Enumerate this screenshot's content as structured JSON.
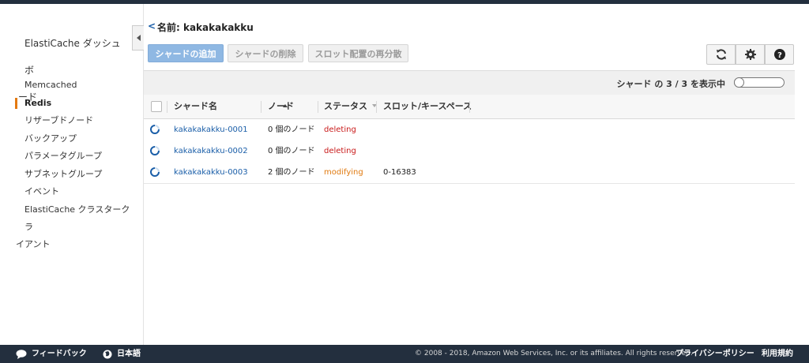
{
  "sidebar": {
    "title_line1": "ElastiCache ダッシュボ",
    "title_line2": "ード",
    "items": [
      {
        "label": "Memcached"
      },
      {
        "label": "Redis"
      },
      {
        "label": "リザーブドノード"
      },
      {
        "label": "バックアップ"
      },
      {
        "label": "パラメータグループ"
      },
      {
        "label": "サブネットグループ"
      },
      {
        "label": "イベント"
      }
    ],
    "client_line1": "ElastiCache クラスタークラ",
    "client_line2": "イアント"
  },
  "header": {
    "back": "<",
    "title": "名前: kakakakakku"
  },
  "toolbar": {
    "add_shard": "シャードの追加",
    "delete_shard": "シャードの削除",
    "redistribute_slots": "スロット配置の再分散"
  },
  "icons": {
    "refresh": "refresh-icon",
    "settings": "gear-icon",
    "help": "help-icon"
  },
  "table": {
    "count_text": "シャード の 3 / 3 を表示中",
    "columns": {
      "name": "シャード名",
      "nodes": "ノード",
      "status": "ステータス",
      "slots": "スロット/キースペース"
    },
    "rows": [
      {
        "name": "kakakakakku-0001",
        "nodes": "0 個のノード",
        "status": "deleting",
        "slots": ""
      },
      {
        "name": "kakakakakku-0002",
        "nodes": "0 個のノード",
        "status": "deleting",
        "slots": ""
      },
      {
        "name": "kakakakakku-0003",
        "nodes": "2 個のノード",
        "status": "modifying",
        "slots": "0-16383"
      }
    ]
  },
  "colors": {
    "accent": "#e47911",
    "link": "#1a5ea8",
    "deleting": "#c91a1a",
    "modifying": "#e07a10",
    "footer_bg": "#232f3e"
  },
  "footer": {
    "feedback": "フィードバック",
    "language": "日本語",
    "copyright": "© 2008 - 2018, Amazon Web Services, Inc. or its affiliates. All rights reserved.",
    "privacy": "プライバシーポリシー",
    "terms": "利用規約"
  }
}
